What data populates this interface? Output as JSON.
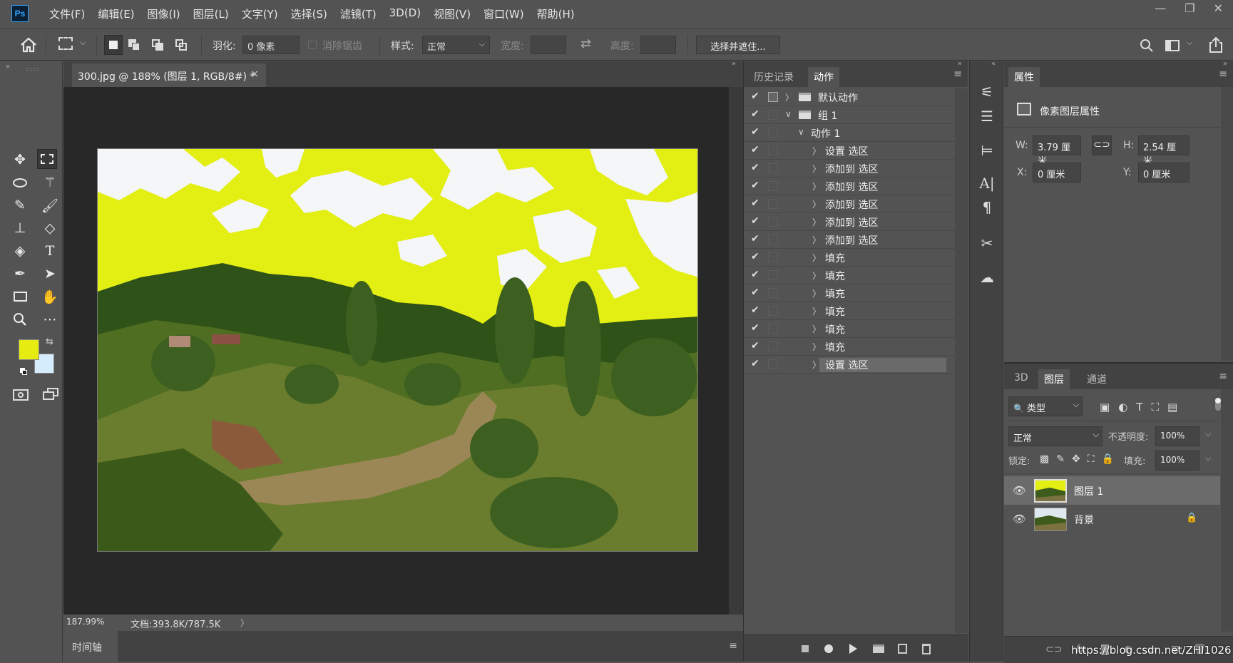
{
  "app": {
    "logo": "Ps"
  },
  "menu": [
    "文件(F)",
    "编辑(E)",
    "图像(I)",
    "图层(L)",
    "文字(Y)",
    "选择(S)",
    "滤镜(T)",
    "3D(D)",
    "视图(V)",
    "窗口(W)",
    "帮助(H)"
  ],
  "window_controls": {
    "minimize": "—",
    "restore": "❐",
    "close": "✕"
  },
  "options": {
    "feather_label": "羽化:",
    "feather_value": "0 像素",
    "antialias_label": "消除锯齿",
    "style_label": "样式:",
    "style_value": "正常",
    "width_label": "宽度:",
    "height_label": "高度:",
    "select_mask_button": "选择并遮住..."
  },
  "document": {
    "tab_title": "300.jpg @ 188% (图层 1, RGB/8#) *",
    "tab_close": "×",
    "zoom": "187.99%",
    "doc_info": "文档:393.8K/787.5K"
  },
  "colors": {
    "foreground": "#e6ec12",
    "background": "#d4ecfb",
    "highlight_fill": "#e3ee13"
  },
  "timeline": {
    "tab": "时间轴"
  },
  "actions_panel": {
    "tabs": [
      "历史记录",
      "动作"
    ],
    "active_tab": "动作",
    "rows": [
      {
        "label": "默认动作",
        "level": 0,
        "type": "set",
        "expanded": false
      },
      {
        "label": "组 1",
        "level": 0,
        "type": "set",
        "expanded": true
      },
      {
        "label": "动作 1",
        "level": 1,
        "type": "action",
        "expanded": true
      },
      {
        "label": "设置 选区",
        "level": 2,
        "type": "step"
      },
      {
        "label": "添加到 选区",
        "level": 2,
        "type": "step"
      },
      {
        "label": "添加到 选区",
        "level": 2,
        "type": "step"
      },
      {
        "label": "添加到 选区",
        "level": 2,
        "type": "step"
      },
      {
        "label": "添加到 选区",
        "level": 2,
        "type": "step"
      },
      {
        "label": "添加到 选区",
        "level": 2,
        "type": "step"
      },
      {
        "label": "填充",
        "level": 2,
        "type": "step"
      },
      {
        "label": "填充",
        "level": 2,
        "type": "step"
      },
      {
        "label": "填充",
        "level": 2,
        "type": "step"
      },
      {
        "label": "填充",
        "level": 2,
        "type": "step"
      },
      {
        "label": "填充",
        "level": 2,
        "type": "step"
      },
      {
        "label": "填充",
        "level": 2,
        "type": "step"
      },
      {
        "label": "设置 选区",
        "level": 2,
        "type": "step",
        "selected": true
      }
    ]
  },
  "properties": {
    "tab": "属性",
    "section": "像素图层属性",
    "w_label": "W:",
    "w_value": "3.79 厘米",
    "h_label": "H:",
    "h_value": "2.54 厘米",
    "x_label": "X:",
    "x_value": "0 厘米",
    "y_label": "Y:",
    "y_value": "0 厘米"
  },
  "layers_panel": {
    "tabs": [
      "3D",
      "图层",
      "通道"
    ],
    "active_tab": "图层",
    "filter_value": "类型",
    "blend_mode": "正常",
    "opacity_label": "不透明度:",
    "opacity_value": "100%",
    "lock_label": "锁定:",
    "fill_label": "填充:",
    "fill_value": "100%",
    "layers": [
      {
        "name": "图层 1",
        "selected": true,
        "locked": false
      },
      {
        "name": "背景",
        "selected": false,
        "locked": true
      }
    ]
  },
  "watermark": "https://blog.csdn.net/ZHI1026"
}
